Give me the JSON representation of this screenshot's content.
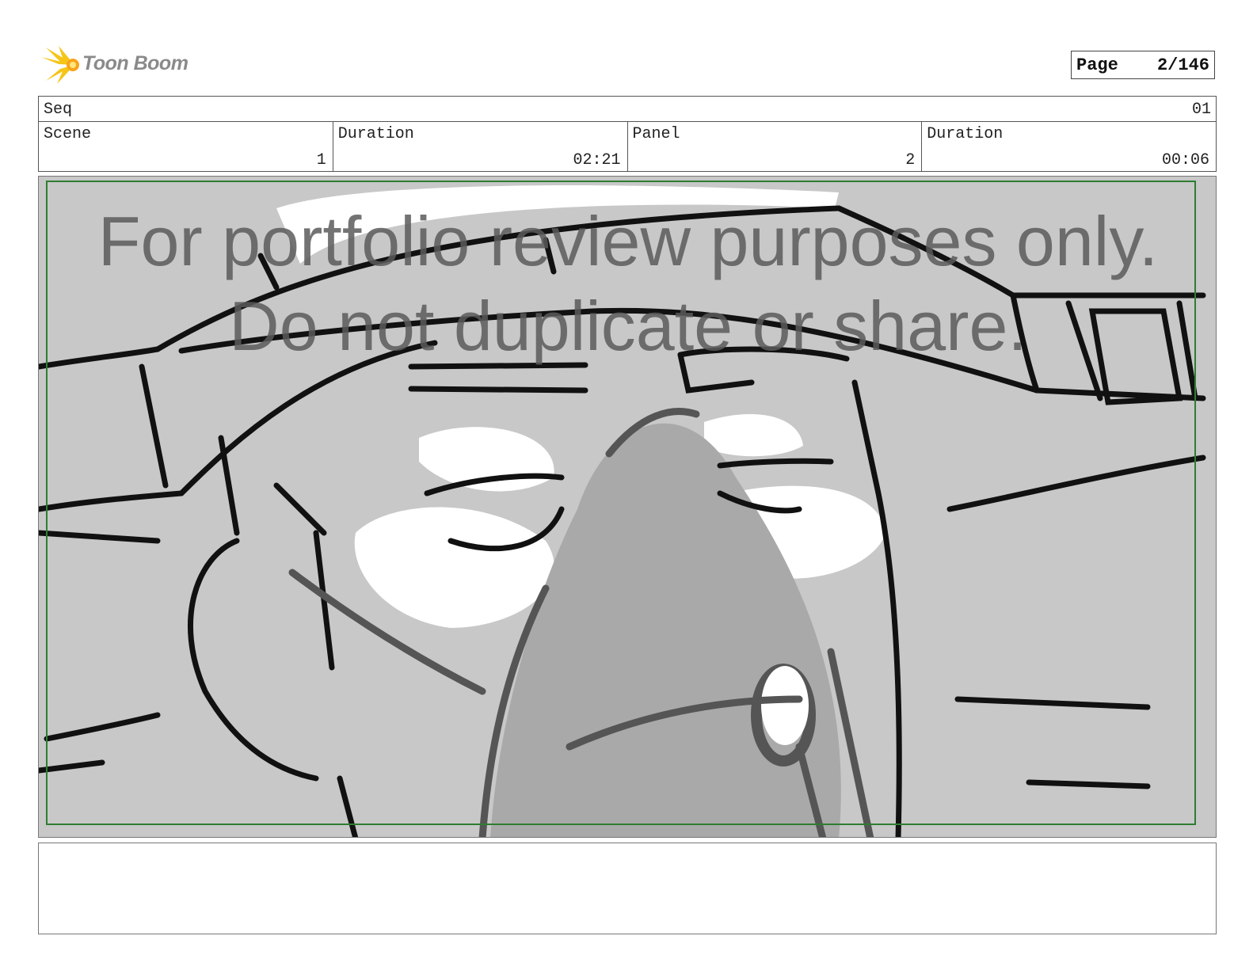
{
  "header": {
    "logo_text": "Toon Boom",
    "page_label": "Page",
    "page_value": "2/146"
  },
  "info": {
    "seq_label": "Seq",
    "seq_value": "01",
    "scene_label": "Scene",
    "scene_value": "1",
    "scene_duration_label": "Duration",
    "scene_duration_value": "02:21",
    "panel_label": "Panel",
    "panel_value": "2",
    "panel_duration_label": "Duration",
    "panel_duration_value": "00:06"
  },
  "panel": {
    "watermark_line1": "For portfolio review purposes only.",
    "watermark_line2": "Do not duplicate or share.",
    "safe_frame_color": "#2e7d32",
    "background_color": "#c8c8c8"
  },
  "notes": {
    "text": ""
  },
  "colors": {
    "logo_accent": "#f5c518",
    "border": "#555555"
  }
}
